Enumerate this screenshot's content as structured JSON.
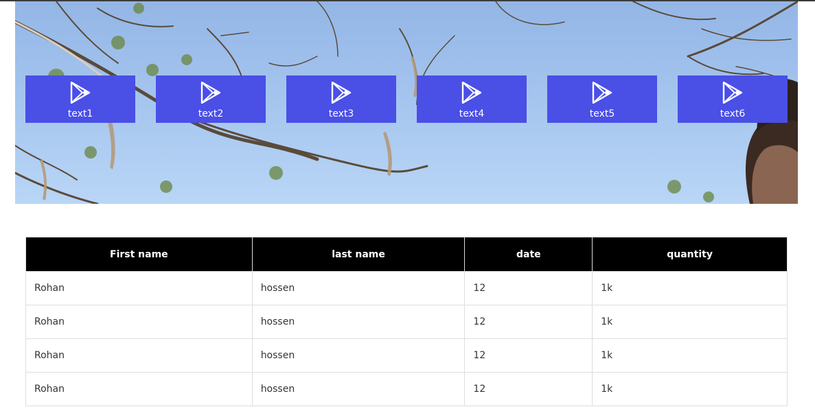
{
  "tiles": [
    {
      "label": "text1",
      "icon": "play-icon"
    },
    {
      "label": "text2",
      "icon": "play-icon"
    },
    {
      "label": "text3",
      "icon": "play-icon"
    },
    {
      "label": "text4",
      "icon": "play-icon"
    },
    {
      "label": "text5",
      "icon": "play-icon"
    },
    {
      "label": "text6",
      "icon": "play-icon"
    }
  ],
  "table": {
    "headers": [
      "First name",
      "last name",
      "date",
      "quantity"
    ],
    "rows": [
      [
        "Rohan",
        "hossen",
        "12",
        "1k"
      ],
      [
        "Rohan",
        "hossen",
        "12",
        "1k"
      ],
      [
        "Rohan",
        "hossen",
        "12",
        "1k"
      ],
      [
        "Rohan",
        "hossen",
        "12",
        "1k"
      ]
    ]
  },
  "colors": {
    "tile_bg": "#4a4fe6",
    "header_bg": "#000000",
    "sky": "#a4c4ee"
  }
}
